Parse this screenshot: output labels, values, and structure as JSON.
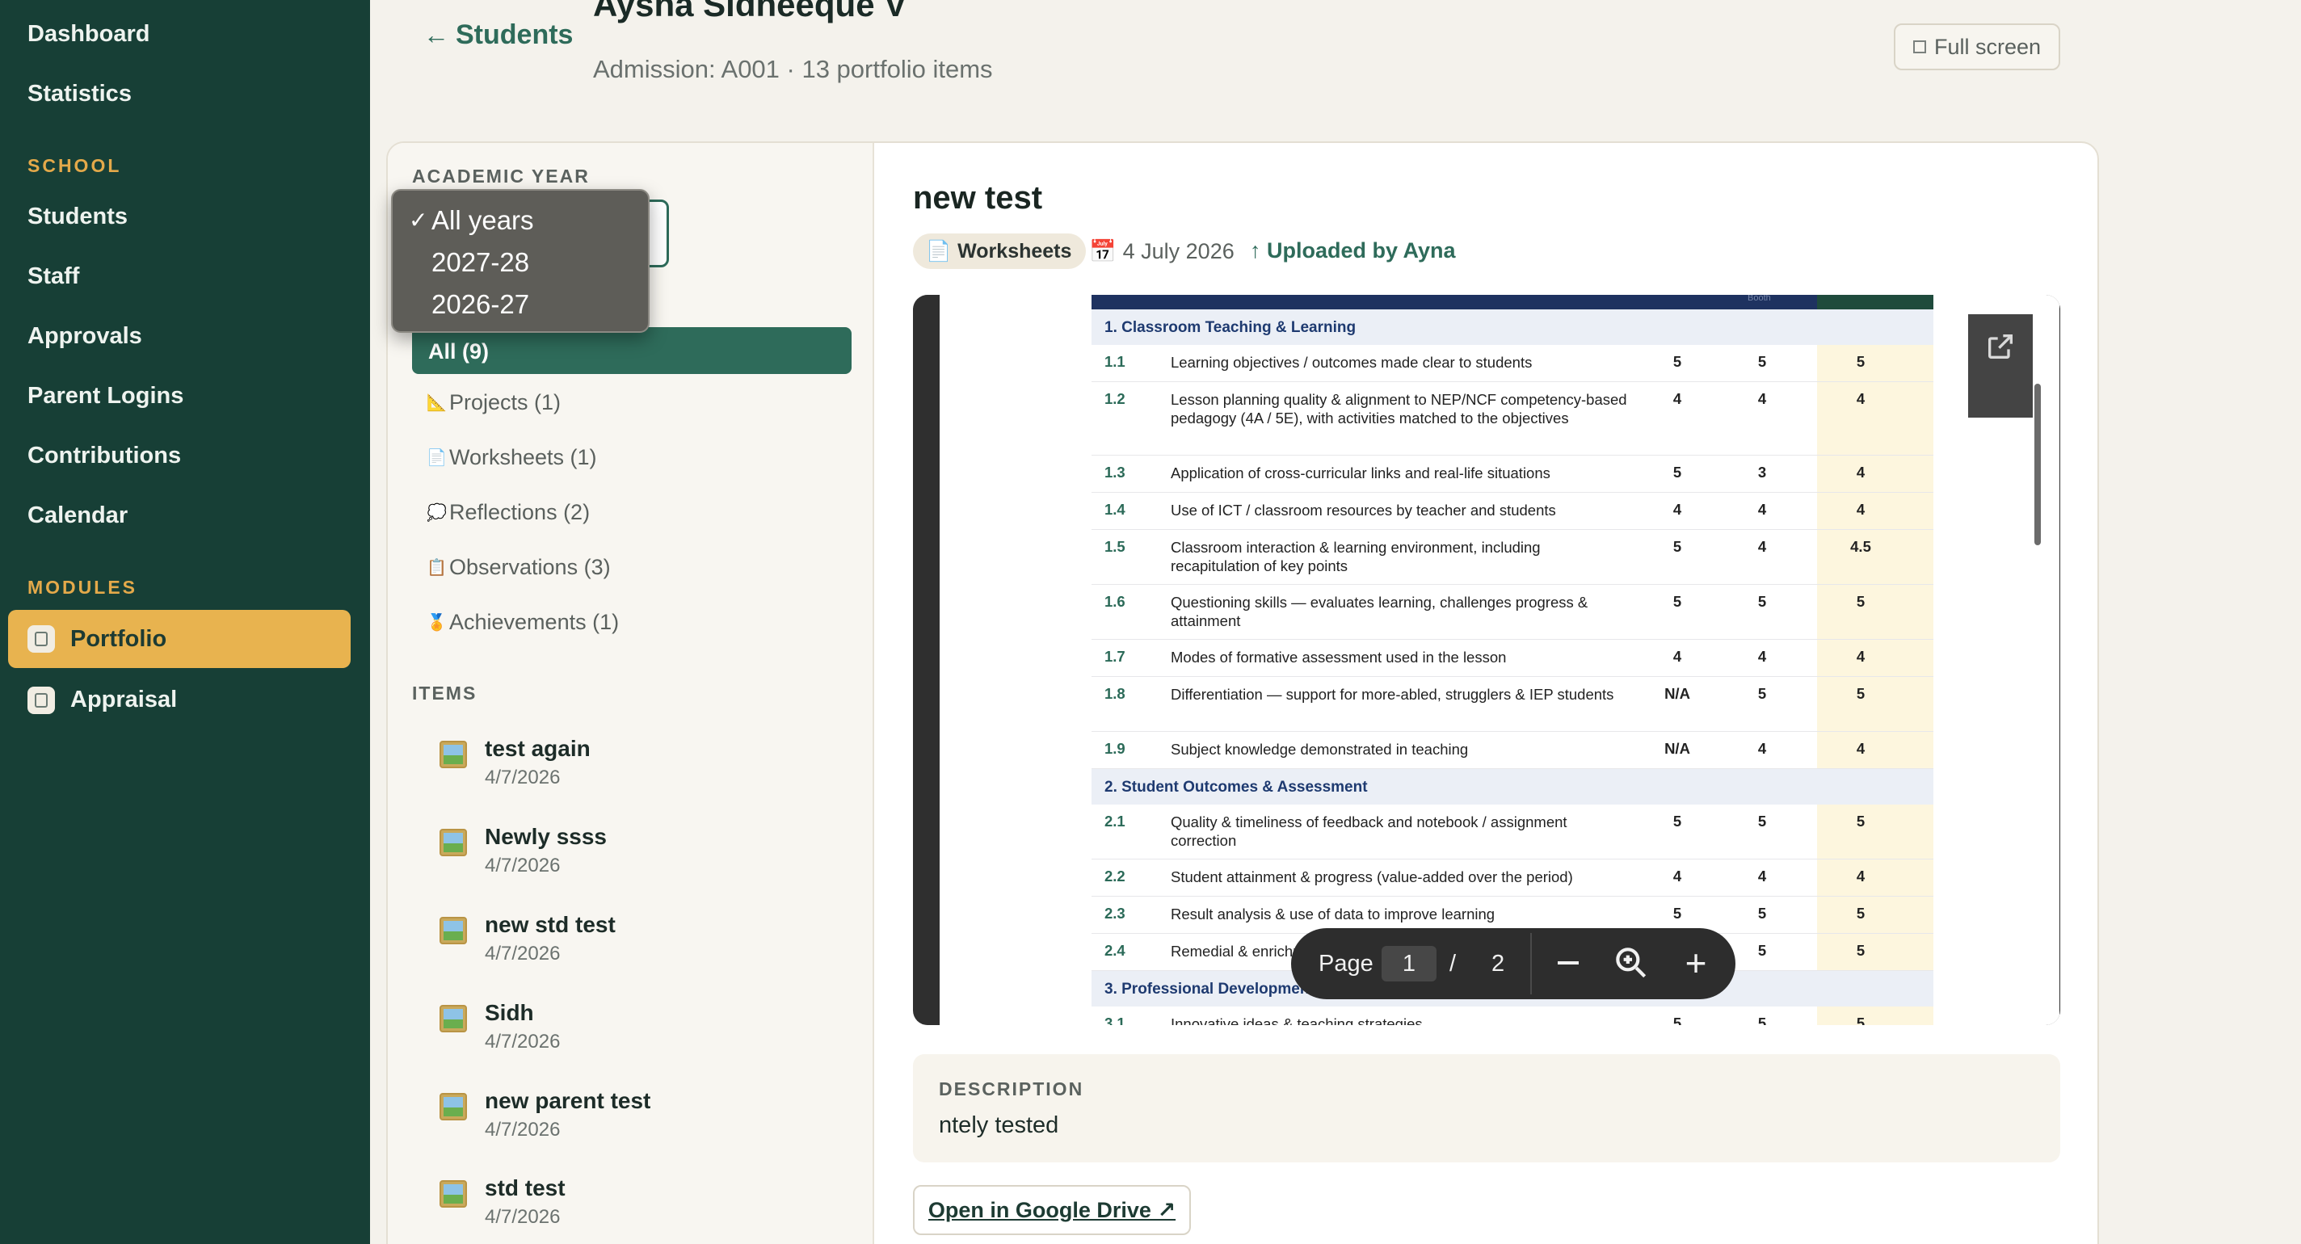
{
  "sidebar": {
    "top_items": [
      {
        "label": "Dashboard"
      },
      {
        "label": "Statistics"
      }
    ],
    "section_school": "SCHOOL",
    "school_items": [
      {
        "label": "Students"
      },
      {
        "label": "Staff"
      },
      {
        "label": "Approvals"
      },
      {
        "label": "Parent Logins"
      },
      {
        "label": "Contributions"
      },
      {
        "label": "Calendar"
      }
    ],
    "section_modules": "MODULES",
    "module_items": [
      {
        "label": "Portfolio",
        "icon": "portfolio-icon",
        "active": true
      },
      {
        "label": "Appraisal",
        "icon": "appraisal-icon",
        "active": false
      }
    ]
  },
  "header": {
    "back_label": "Students",
    "student_name": "Aysha Sidheeque V",
    "admission_line": "Admission: A001 · 13 portfolio items",
    "fullscreen_label": "Full screen"
  },
  "filters": {
    "academic_year_heading": "ACADEMIC YEAR",
    "year_options": [
      "All years",
      "2027-28",
      "2026-27"
    ],
    "selected_year": "All years",
    "categories": [
      {
        "label": "All (9)",
        "icon": "",
        "active": true
      },
      {
        "label": "Projects (1)",
        "icon": "📐"
      },
      {
        "label": "Worksheets (1)",
        "icon": "📄"
      },
      {
        "label": "Reflections (2)",
        "icon": "💭"
      },
      {
        "label": "Observations (3)",
        "icon": "📋"
      },
      {
        "label": "Achievements (1)",
        "icon": "🏅"
      }
    ],
    "items_heading": "ITEMS",
    "items": [
      {
        "title": "test again",
        "date": "4/7/2026"
      },
      {
        "title": "Newly ssss",
        "date": "4/7/2026"
      },
      {
        "title": "new std test",
        "date": "4/7/2026"
      },
      {
        "title": "Sidh",
        "date": "4/7/2026"
      },
      {
        "title": "new parent test",
        "date": "4/7/2026"
      },
      {
        "title": "std test",
        "date": "4/7/2026"
      }
    ]
  },
  "detail": {
    "title": "new test",
    "category_badge": "Worksheets",
    "date": "4 July 2026",
    "uploaded_by": "Uploaded by Ayna",
    "description_heading": "DESCRIPTION",
    "description": "ntely tested",
    "drive_button": "Open in Google Drive ↗"
  },
  "pdf": {
    "header_partial": "Booth",
    "page_label": "Page",
    "current_page": "1",
    "separator": "/",
    "total_pages": "2",
    "sections": [
      {
        "title": "1. Classroom Teaching & Learning"
      },
      {
        "title": "2. Student Outcomes & Assessment"
      },
      {
        "title": "3. Professional Development & Growth"
      }
    ],
    "rows": [
      {
        "num": "1.1",
        "text": "Learning objectives / outcomes made clear to students",
        "a": "5",
        "b": "5",
        "c": "5"
      },
      {
        "num": "1.2",
        "text": "Lesson planning quality & alignment to NEP/NCF competency-based pedagogy (4A / 5E), with activities matched to the objectives",
        "a": "4",
        "b": "4",
        "c": "4"
      },
      {
        "num": "1.3",
        "text": "Application of cross-curricular links and real-life situations",
        "a": "5",
        "b": "3",
        "c": "4"
      },
      {
        "num": "1.4",
        "text": "Use of ICT / classroom resources by teacher and students",
        "a": "4",
        "b": "4",
        "c": "4"
      },
      {
        "num": "1.5",
        "text": "Classroom interaction & learning environment, including recapitulation of key points",
        "a": "5",
        "b": "4",
        "c": "4.5"
      },
      {
        "num": "1.6",
        "text": "Questioning skills — evaluates learning, challenges progress & attainment",
        "a": "5",
        "b": "5",
        "c": "5"
      },
      {
        "num": "1.7",
        "text": "Modes of formative assessment used in the lesson",
        "a": "4",
        "b": "4",
        "c": "4"
      },
      {
        "num": "1.8",
        "text": "Differentiation — support for more-abled, strugglers & IEP students",
        "a": "N/A",
        "b": "5",
        "c": "5"
      },
      {
        "num": "1.9",
        "text": "Subject knowledge demonstrated in teaching",
        "a": "N/A",
        "b": "4",
        "c": "4"
      },
      {
        "num": "2.1",
        "text": "Quality & timeliness of feedback and notebook / assignment correction",
        "a": "5",
        "b": "5",
        "c": "5"
      },
      {
        "num": "2.2",
        "text": "Student attainment & progress (value-added over the period)",
        "a": "4",
        "b": "4",
        "c": "4"
      },
      {
        "num": "2.3",
        "text": "Result analysis & use of data to improve learning",
        "a": "5",
        "b": "5",
        "c": "5"
      },
      {
        "num": "2.4",
        "text": "Remedial & enrichment support provided to students",
        "a": "5",
        "b": "5",
        "c": "5"
      },
      {
        "num": "3.1",
        "text": "Innovative ideas & teaching strategies",
        "a": "5",
        "b": "5",
        "c": "5"
      }
    ]
  },
  "colors": {
    "sidebar_bg": "#173f36",
    "accent_green": "#2e6b5a",
    "active_nav": "#e8b34f",
    "section_label": "#e4a94a"
  }
}
